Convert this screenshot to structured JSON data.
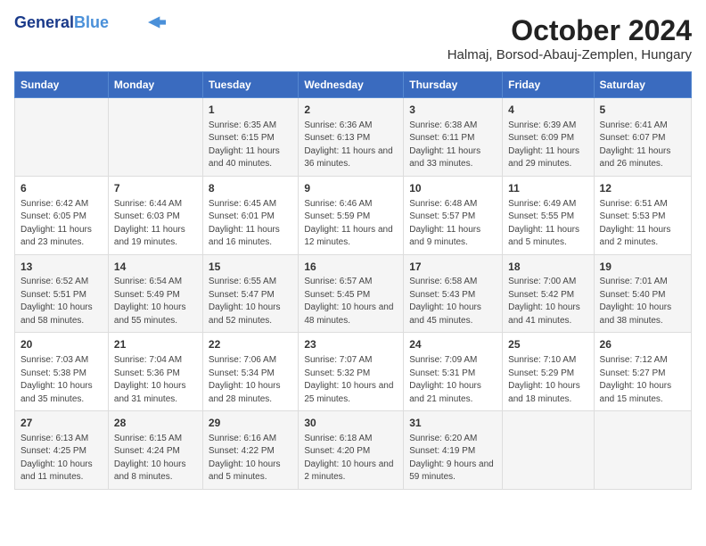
{
  "logo": {
    "line1": "General",
    "line2": "Blue"
  },
  "title": "October 2024",
  "location": "Halmaj, Borsod-Abauj-Zemplen, Hungary",
  "weekdays": [
    "Sunday",
    "Monday",
    "Tuesday",
    "Wednesday",
    "Thursday",
    "Friday",
    "Saturday"
  ],
  "weeks": [
    [
      {
        "day": "",
        "info": ""
      },
      {
        "day": "",
        "info": ""
      },
      {
        "day": "1",
        "info": "Sunrise: 6:35 AM\nSunset: 6:15 PM\nDaylight: 11 hours and 40 minutes."
      },
      {
        "day": "2",
        "info": "Sunrise: 6:36 AM\nSunset: 6:13 PM\nDaylight: 11 hours and 36 minutes."
      },
      {
        "day": "3",
        "info": "Sunrise: 6:38 AM\nSunset: 6:11 PM\nDaylight: 11 hours and 33 minutes."
      },
      {
        "day": "4",
        "info": "Sunrise: 6:39 AM\nSunset: 6:09 PM\nDaylight: 11 hours and 29 minutes."
      },
      {
        "day": "5",
        "info": "Sunrise: 6:41 AM\nSunset: 6:07 PM\nDaylight: 11 hours and 26 minutes."
      }
    ],
    [
      {
        "day": "6",
        "info": "Sunrise: 6:42 AM\nSunset: 6:05 PM\nDaylight: 11 hours and 23 minutes."
      },
      {
        "day": "7",
        "info": "Sunrise: 6:44 AM\nSunset: 6:03 PM\nDaylight: 11 hours and 19 minutes."
      },
      {
        "day": "8",
        "info": "Sunrise: 6:45 AM\nSunset: 6:01 PM\nDaylight: 11 hours and 16 minutes."
      },
      {
        "day": "9",
        "info": "Sunrise: 6:46 AM\nSunset: 5:59 PM\nDaylight: 11 hours and 12 minutes."
      },
      {
        "day": "10",
        "info": "Sunrise: 6:48 AM\nSunset: 5:57 PM\nDaylight: 11 hours and 9 minutes."
      },
      {
        "day": "11",
        "info": "Sunrise: 6:49 AM\nSunset: 5:55 PM\nDaylight: 11 hours and 5 minutes."
      },
      {
        "day": "12",
        "info": "Sunrise: 6:51 AM\nSunset: 5:53 PM\nDaylight: 11 hours and 2 minutes."
      }
    ],
    [
      {
        "day": "13",
        "info": "Sunrise: 6:52 AM\nSunset: 5:51 PM\nDaylight: 10 hours and 58 minutes."
      },
      {
        "day": "14",
        "info": "Sunrise: 6:54 AM\nSunset: 5:49 PM\nDaylight: 10 hours and 55 minutes."
      },
      {
        "day": "15",
        "info": "Sunrise: 6:55 AM\nSunset: 5:47 PM\nDaylight: 10 hours and 52 minutes."
      },
      {
        "day": "16",
        "info": "Sunrise: 6:57 AM\nSunset: 5:45 PM\nDaylight: 10 hours and 48 minutes."
      },
      {
        "day": "17",
        "info": "Sunrise: 6:58 AM\nSunset: 5:43 PM\nDaylight: 10 hours and 45 minutes."
      },
      {
        "day": "18",
        "info": "Sunrise: 7:00 AM\nSunset: 5:42 PM\nDaylight: 10 hours and 41 minutes."
      },
      {
        "day": "19",
        "info": "Sunrise: 7:01 AM\nSunset: 5:40 PM\nDaylight: 10 hours and 38 minutes."
      }
    ],
    [
      {
        "day": "20",
        "info": "Sunrise: 7:03 AM\nSunset: 5:38 PM\nDaylight: 10 hours and 35 minutes."
      },
      {
        "day": "21",
        "info": "Sunrise: 7:04 AM\nSunset: 5:36 PM\nDaylight: 10 hours and 31 minutes."
      },
      {
        "day": "22",
        "info": "Sunrise: 7:06 AM\nSunset: 5:34 PM\nDaylight: 10 hours and 28 minutes."
      },
      {
        "day": "23",
        "info": "Sunrise: 7:07 AM\nSunset: 5:32 PM\nDaylight: 10 hours and 25 minutes."
      },
      {
        "day": "24",
        "info": "Sunrise: 7:09 AM\nSunset: 5:31 PM\nDaylight: 10 hours and 21 minutes."
      },
      {
        "day": "25",
        "info": "Sunrise: 7:10 AM\nSunset: 5:29 PM\nDaylight: 10 hours and 18 minutes."
      },
      {
        "day": "26",
        "info": "Sunrise: 7:12 AM\nSunset: 5:27 PM\nDaylight: 10 hours and 15 minutes."
      }
    ],
    [
      {
        "day": "27",
        "info": "Sunrise: 6:13 AM\nSunset: 4:25 PM\nDaylight: 10 hours and 11 minutes."
      },
      {
        "day": "28",
        "info": "Sunrise: 6:15 AM\nSunset: 4:24 PM\nDaylight: 10 hours and 8 minutes."
      },
      {
        "day": "29",
        "info": "Sunrise: 6:16 AM\nSunset: 4:22 PM\nDaylight: 10 hours and 5 minutes."
      },
      {
        "day": "30",
        "info": "Sunrise: 6:18 AM\nSunset: 4:20 PM\nDaylight: 10 hours and 2 minutes."
      },
      {
        "day": "31",
        "info": "Sunrise: 6:20 AM\nSunset: 4:19 PM\nDaylight: 9 hours and 59 minutes."
      },
      {
        "day": "",
        "info": ""
      },
      {
        "day": "",
        "info": ""
      }
    ]
  ]
}
